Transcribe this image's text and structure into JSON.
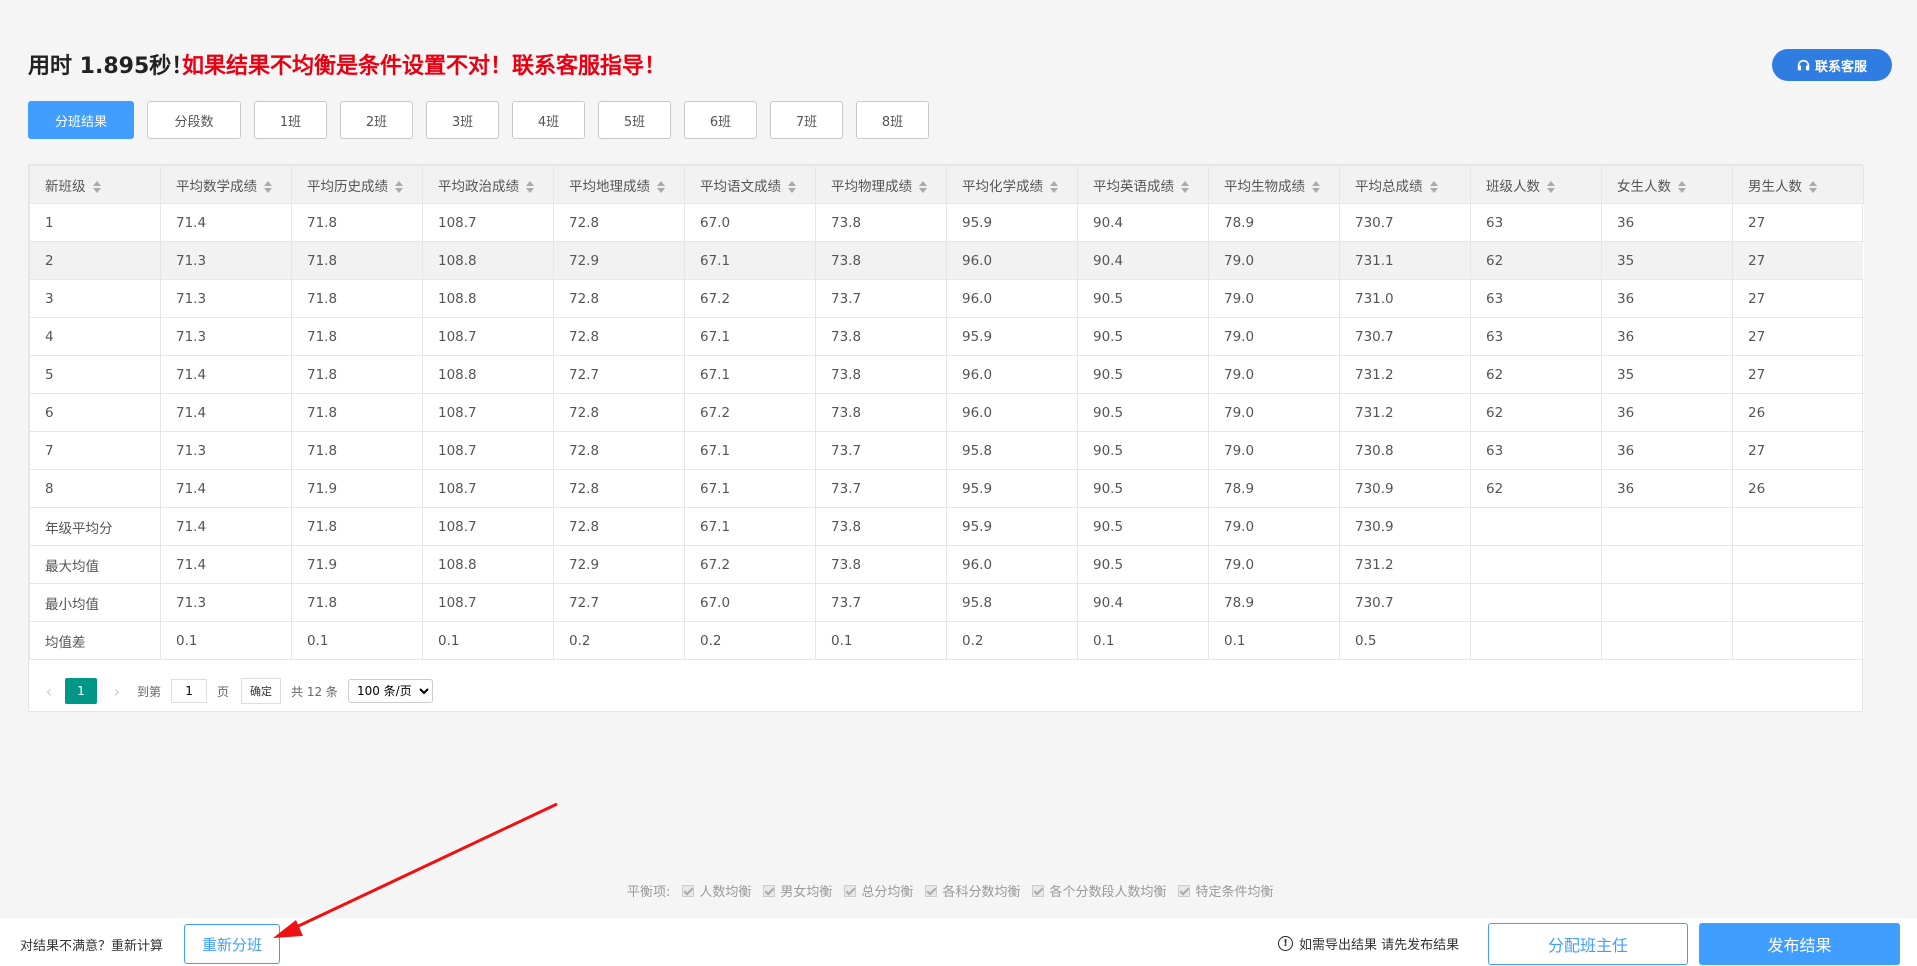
{
  "header": {
    "time_text": "用时 1.895秒！",
    "warning_text": "如果结果不均衡是条件设置不对！联系客服指导！",
    "contact_label": "联系客服",
    "contact_icon": "headset-icon"
  },
  "tabs": [
    {
      "label": "分班结果",
      "active": true
    },
    {
      "label": "分段数"
    },
    {
      "label": "1班"
    },
    {
      "label": "2班"
    },
    {
      "label": "3班"
    },
    {
      "label": "4班"
    },
    {
      "label": "5班"
    },
    {
      "label": "6班"
    },
    {
      "label": "7班"
    },
    {
      "label": "8班"
    }
  ],
  "table": {
    "headers": [
      "新班级",
      "平均数学成绩",
      "平均历史成绩",
      "平均政治成绩",
      "平均地理成绩",
      "平均语文成绩",
      "平均物理成绩",
      "平均化学成绩",
      "平均英语成绩",
      "平均生物成绩",
      "平均总成绩",
      "班级人数",
      "女生人数",
      "男生人数"
    ],
    "rows": [
      [
        "1",
        "71.4",
        "71.8",
        "108.7",
        "72.8",
        "67.0",
        "73.8",
        "95.9",
        "90.4",
        "78.9",
        "730.7",
        "63",
        "36",
        "27"
      ],
      [
        "2",
        "71.3",
        "71.8",
        "108.8",
        "72.9",
        "67.1",
        "73.8",
        "96.0",
        "90.4",
        "79.0",
        "731.1",
        "62",
        "35",
        "27"
      ],
      [
        "3",
        "71.3",
        "71.8",
        "108.8",
        "72.8",
        "67.2",
        "73.7",
        "96.0",
        "90.5",
        "79.0",
        "731.0",
        "63",
        "36",
        "27"
      ],
      [
        "4",
        "71.3",
        "71.8",
        "108.7",
        "72.8",
        "67.1",
        "73.8",
        "95.9",
        "90.5",
        "79.0",
        "730.7",
        "63",
        "36",
        "27"
      ],
      [
        "5",
        "71.4",
        "71.8",
        "108.8",
        "72.7",
        "67.1",
        "73.8",
        "96.0",
        "90.5",
        "79.0",
        "731.2",
        "62",
        "35",
        "27"
      ],
      [
        "6",
        "71.4",
        "71.8",
        "108.7",
        "72.8",
        "67.2",
        "73.8",
        "96.0",
        "90.5",
        "79.0",
        "731.2",
        "62",
        "36",
        "26"
      ],
      [
        "7",
        "71.3",
        "71.8",
        "108.7",
        "72.8",
        "67.1",
        "73.7",
        "95.8",
        "90.5",
        "79.0",
        "730.8",
        "63",
        "36",
        "27"
      ],
      [
        "8",
        "71.4",
        "71.9",
        "108.7",
        "72.8",
        "67.1",
        "73.7",
        "95.9",
        "90.5",
        "78.9",
        "730.9",
        "62",
        "36",
        "26"
      ],
      [
        "年级平均分",
        "71.4",
        "71.8",
        "108.7",
        "72.8",
        "67.1",
        "73.8",
        "95.9",
        "90.5",
        "79.0",
        "730.9",
        "",
        "",
        ""
      ],
      [
        "最大均值",
        "71.4",
        "71.9",
        "108.8",
        "72.9",
        "67.2",
        "73.8",
        "96.0",
        "90.5",
        "79.0",
        "731.2",
        "",
        "",
        ""
      ],
      [
        "最小均值",
        "71.3",
        "71.8",
        "108.7",
        "72.7",
        "67.0",
        "73.7",
        "95.8",
        "90.4",
        "78.9",
        "730.7",
        "",
        "",
        ""
      ],
      [
        "均值差",
        "0.1",
        "0.1",
        "0.1",
        "0.2",
        "0.2",
        "0.1",
        "0.2",
        "0.1",
        "0.1",
        "0.5",
        "",
        "",
        ""
      ]
    ]
  },
  "pagination": {
    "prev": "‹",
    "current_page": "1",
    "next": "›",
    "goto_label": "到第",
    "goto_value": "1",
    "page_label": "页",
    "confirm_label": "确定",
    "total_label": "共 12 条",
    "page_size": "100 条/页",
    "page_size_options": [
      "100 条/页"
    ]
  },
  "balance": {
    "label": "平衡项:",
    "items": [
      "人数均衡",
      "男女均衡",
      "总分均衡",
      "各科分数均衡",
      "各个分数段人数均衡",
      "特定条件均衡"
    ]
  },
  "footer": {
    "retry_text": "对结果不满意？重新计算",
    "redo_label": "重新分班",
    "export_note": "如需导出结果 请先发布结果",
    "assign_label": "分配班主任",
    "publish_label": "发布结果"
  },
  "colors": {
    "primary": "#409eff",
    "warning": "#e60012",
    "pager_active": "#009688",
    "annotation_arrow": "#ee1111"
  }
}
